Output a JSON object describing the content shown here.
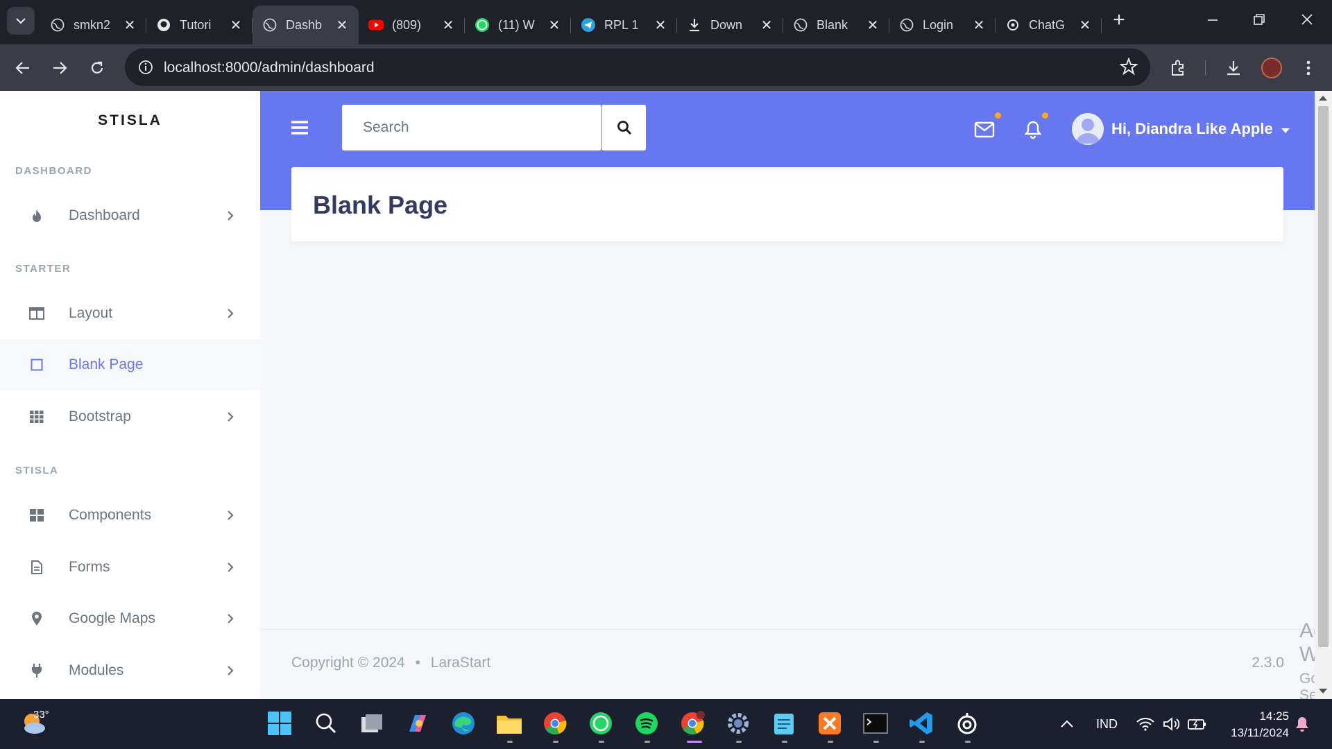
{
  "browser": {
    "tabs": [
      {
        "title": "smkn2",
        "icon": "globe-icon"
      },
      {
        "title": "Tutori",
        "icon": "github-icon"
      },
      {
        "title": "Dashb",
        "icon": "globe-icon",
        "active": true
      },
      {
        "title": "(809)",
        "icon": "youtube-icon"
      },
      {
        "title": "(11) W",
        "icon": "whatsapp-icon"
      },
      {
        "title": "RPL 1",
        "icon": "telegram-icon"
      },
      {
        "title": "Down",
        "icon": "download-icon"
      },
      {
        "title": "Blank",
        "icon": "globe-icon"
      },
      {
        "title": "Login",
        "icon": "globe-icon"
      },
      {
        "title": "ChatG",
        "icon": "chatgpt-icon"
      }
    ],
    "url": "localhost:8000/admin/dashboard"
  },
  "sidebar": {
    "brand": "STISLA",
    "sections": {
      "dashboard": "DASHBOARD",
      "starter": "STARTER",
      "stisla": "STISLA"
    },
    "items": [
      {
        "label": "Dashboard",
        "icon": "fire-icon"
      },
      {
        "label": "Layout",
        "icon": "columns-icon"
      },
      {
        "label": "Blank Page",
        "icon": "square-icon",
        "active": true
      },
      {
        "label": "Bootstrap",
        "icon": "grid-icon"
      },
      {
        "label": "Components",
        "icon": "th-large-icon"
      },
      {
        "label": "Forms",
        "icon": "file-alt-icon"
      },
      {
        "label": "Google Maps",
        "icon": "map-marker-icon"
      },
      {
        "label": "Modules",
        "icon": "plug-icon"
      }
    ]
  },
  "navbar": {
    "search_placeholder": "Search",
    "user_greeting": "Hi, Diandra Like Apple"
  },
  "main": {
    "title": "Blank Page"
  },
  "footer": {
    "copyright": "Copyright © 2024",
    "separator": "•",
    "brand": "LaraStart",
    "version": "2.3.0"
  },
  "watermark": {
    "line1": "Activate Windows",
    "line2": "Go to Settings to activate Windows."
  },
  "taskbar": {
    "temperature": "33°",
    "language": "IND",
    "time": "14:25",
    "date": "13/11/2024"
  },
  "colors": {
    "primary": "#6777ef",
    "warning": "#ffa426",
    "chrome_dark": "#1f2128",
    "chrome_mid": "#3a3d47"
  }
}
